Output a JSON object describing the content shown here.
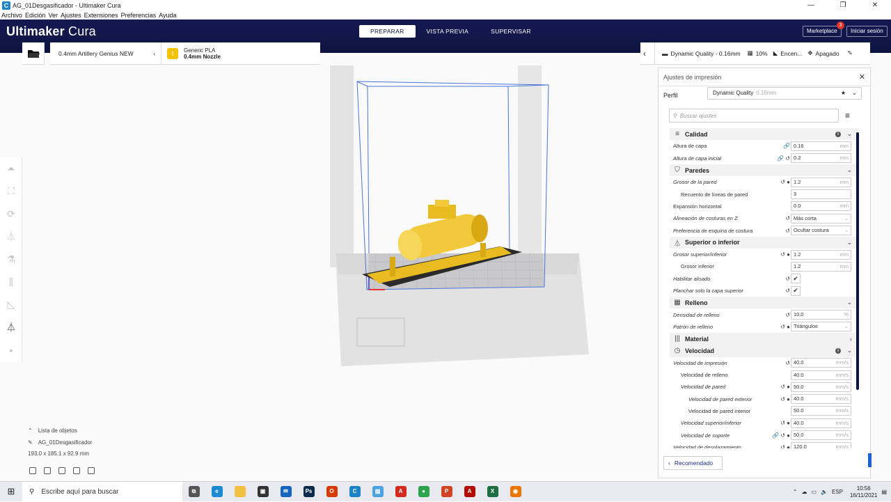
{
  "window": {
    "title": "AG_01Desgasificador - Ultimaker Cura",
    "app_icon": "cura-icon"
  },
  "menu": [
    "Archivo",
    "Edición",
    "Ver",
    "Ajustes",
    "Extensiones",
    "Preferencias",
    "Ayuda"
  ],
  "header": {
    "brand_bold": "Ultimaker",
    "brand_light": " Cura",
    "tabs": [
      "PREPARAR",
      "VISTA PREVIA",
      "SUPERVISAR"
    ],
    "marketplace": "Marketplace",
    "marketplace_badge": "3",
    "signin": "Iniciar sesión"
  },
  "stagebar": {
    "printer": "0.4mm Artillery Genius NEW",
    "material_name": "Generic PLA",
    "material_nozzle": "0.4mm Nozzle",
    "profile": "Dynamic Quality - 0.16mm",
    "infill": "10%",
    "support": "Encen...",
    "adhesion": "Apagado"
  },
  "objects": {
    "list_label": "Lista de objetos",
    "name": "AG_01Desgasificador",
    "dims": "193.0 x 185.1 x 92.9 mm"
  },
  "panel": {
    "title": "Ajustes de impresión",
    "profile_label": "Perfil",
    "profile_value": "Dynamic Quality",
    "profile_sub": "0.16mm",
    "search_placeholder": "Buscar ajustes",
    "recommended": "Recomendado",
    "rows": [
      {
        "type": "cat",
        "icon": "≡",
        "label": "Calidad",
        "info": true,
        "exp": "⌄"
      },
      {
        "type": "row",
        "label": "Altura de capa",
        "indent": 0,
        "italic": false,
        "icons": "🔗",
        "value": "0.16",
        "unit": "mm"
      },
      {
        "type": "row",
        "label": "Altura de capa inicial",
        "indent": 0,
        "italic": true,
        "icons": "🔗 ↺",
        "value": "0.2",
        "unit": "mm"
      },
      {
        "type": "cat",
        "icon": "⛉",
        "label": "Paredes",
        "info": false,
        "exp": "⌄"
      },
      {
        "type": "row",
        "label": "Grosor de la pared",
        "indent": 0,
        "italic": true,
        "icons": "↺ ●",
        "value": "1.2",
        "unit": "mm"
      },
      {
        "type": "row",
        "label": "Recuento de líneas de pared",
        "indent": 1,
        "italic": false,
        "icons": "",
        "value": "3",
        "unit": ""
      },
      {
        "type": "row",
        "label": "Expansión horizontal",
        "indent": 0,
        "italic": false,
        "icons": "",
        "value": "0.0",
        "unit": "mm"
      },
      {
        "type": "row",
        "label": "Alineación de costuras en Z",
        "indent": 0,
        "italic": true,
        "icons": "↺",
        "value": "Más corta",
        "unit": "⌄"
      },
      {
        "type": "row",
        "label": "Preferencia de esquina de costura",
        "indent": 0,
        "italic": true,
        "icons": "↺",
        "value": "Ocultar costura",
        "unit": "⌄"
      },
      {
        "type": "cat",
        "icon": "⏃",
        "label": "Superior o inferior",
        "info": false,
        "exp": "⌄"
      },
      {
        "type": "row",
        "label": "Grosor superior/inferior",
        "indent": 0,
        "italic": true,
        "icons": "↺ ●",
        "value": "1.2",
        "unit": "mm"
      },
      {
        "type": "row",
        "label": "Grosor inferior",
        "indent": 1,
        "italic": false,
        "icons": "",
        "value": "1.2",
        "unit": "mm"
      },
      {
        "type": "check",
        "label": "Habilitar alisado",
        "indent": 0,
        "italic": true,
        "icons": "↺",
        "checked": "✔"
      },
      {
        "type": "check",
        "label": "Planchar solo la capa superior",
        "indent": 0,
        "italic": true,
        "icons": "↺",
        "checked": "✔"
      },
      {
        "type": "cat",
        "icon": "▦",
        "label": "Relleno",
        "info": false,
        "exp": "⌄"
      },
      {
        "type": "row",
        "label": "Densidad de relleno",
        "indent": 0,
        "italic": true,
        "icons": "↺",
        "value": "10.0",
        "unit": "%"
      },
      {
        "type": "row",
        "label": "Patrón de relleno",
        "indent": 0,
        "italic": true,
        "icons": "↺ ●",
        "value": "Triángulos",
        "unit": "⌄"
      },
      {
        "type": "cat",
        "icon": "|||",
        "label": "Material",
        "info": false,
        "exp": "‹"
      },
      {
        "type": "cat",
        "icon": "◷",
        "label": "Velocidad",
        "info": true,
        "exp": "⌄"
      },
      {
        "type": "row",
        "label": "Velocidad de impresión",
        "indent": 0,
        "italic": true,
        "icons": "↺",
        "value": "40.0",
        "unit": "mm/s"
      },
      {
        "type": "row",
        "label": "Velocidad de relleno",
        "indent": 1,
        "italic": false,
        "icons": "",
        "value": "40.0",
        "unit": "mm/s"
      },
      {
        "type": "row",
        "label": "Velocidad de pared",
        "indent": 1,
        "italic": true,
        "icons": "↺ ●",
        "value": "50.0",
        "unit": "mm/s"
      },
      {
        "type": "row",
        "label": "Velocidad de pared exterior",
        "indent": 2,
        "italic": true,
        "icons": "↺ ●",
        "value": "40.0",
        "unit": "mm/s"
      },
      {
        "type": "row",
        "label": "Velocidad de pared interior",
        "indent": 2,
        "italic": false,
        "icons": "",
        "value": "50.0",
        "unit": "mm/s"
      },
      {
        "type": "row",
        "label": "Velocidad superior/inferior",
        "indent": 1,
        "italic": true,
        "icons": "↺ ●",
        "value": "40.0",
        "unit": "mm/s"
      },
      {
        "type": "row",
        "label": "Velocidad de soporte",
        "indent": 1,
        "italic": true,
        "icons": "🔗 ↺ ●",
        "value": "50.0",
        "unit": "mm/s"
      },
      {
        "type": "row",
        "label": "Velocidad de desplazamiento",
        "indent": 0,
        "italic": true,
        "icons": "↺ ●",
        "value": "120.0",
        "unit": "mm/s"
      }
    ]
  },
  "taskbar": {
    "search": "Escribe aquí para buscar",
    "apps": [
      {
        "name": "task-view-icon",
        "color": "#555555",
        "glyph": "⧉"
      },
      {
        "name": "edge-icon",
        "color": "#1b8ad3",
        "glyph": "e"
      },
      {
        "name": "file-explorer-icon",
        "color": "#f2c040",
        "glyph": ""
      },
      {
        "name": "store-icon",
        "color": "#333333",
        "glyph": "▣"
      },
      {
        "name": "mail-icon",
        "color": "#1565c0",
        "glyph": "✉"
      },
      {
        "name": "photoshop-icon",
        "color": "#0b2b4c",
        "glyph": "Ps"
      },
      {
        "name": "office-icon",
        "color": "#d83b01",
        "glyph": "O"
      },
      {
        "name": "cura-icon",
        "color": "#1c84c6",
        "glyph": "C"
      },
      {
        "name": "photos-icon",
        "color": "#4ba3e2",
        "glyph": "▨"
      },
      {
        "name": "acrobat-icon",
        "color": "#d42a1f",
        "glyph": "A"
      },
      {
        "name": "chrome-icon",
        "color": "#2ea44f",
        "glyph": "●"
      },
      {
        "name": "powerpoint-icon",
        "color": "#d04423",
        "glyph": "P"
      },
      {
        "name": "acrobat-reader-icon",
        "color": "#b30b00",
        "glyph": "A"
      },
      {
        "name": "excel-icon",
        "color": "#1d6f42",
        "glyph": "X"
      },
      {
        "name": "blender-icon",
        "color": "#ea7600",
        "glyph": "◉"
      }
    ],
    "lang": "ESP",
    "time": "10:56",
    "date": "16/11/2021"
  }
}
